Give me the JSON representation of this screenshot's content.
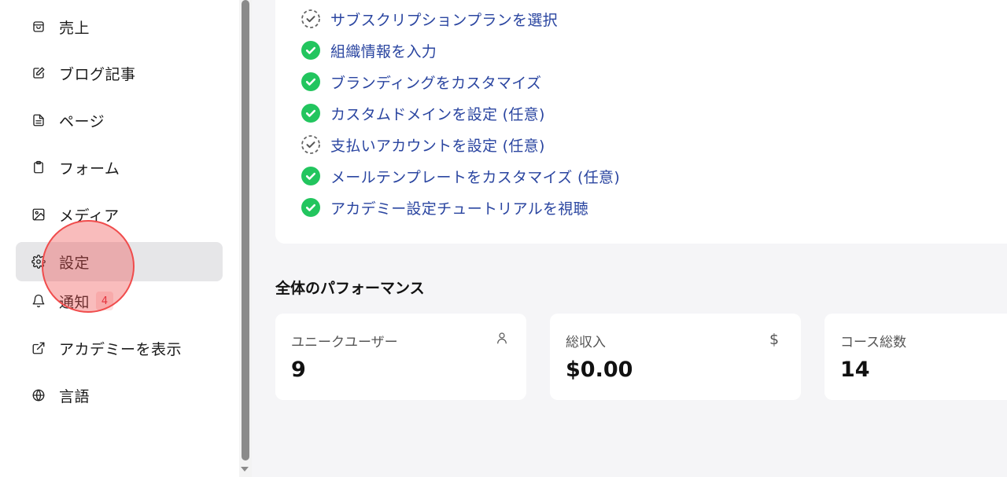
{
  "sidebar": {
    "items": [
      {
        "label": "売上",
        "icon": "shopping-bag-icon",
        "active": false
      },
      {
        "label": "ブログ記事",
        "icon": "edit-icon",
        "active": false
      },
      {
        "label": "ページ",
        "icon": "file-text-icon",
        "active": false
      },
      {
        "label": "フォーム",
        "icon": "clipboard-icon",
        "active": false
      },
      {
        "label": "メディア",
        "icon": "image-icon",
        "active": false
      },
      {
        "label": "設定",
        "icon": "gear-icon",
        "active": true
      },
      {
        "label": "通知",
        "icon": "bell-icon",
        "active": false,
        "badge": "4"
      },
      {
        "label": "アカデミーを表示",
        "icon": "external-link-icon",
        "active": false
      },
      {
        "label": "言語",
        "icon": "globe-icon",
        "active": false
      }
    ]
  },
  "checklist": {
    "items": [
      {
        "label": "サブスクリプションプランを選択",
        "status": "pending"
      },
      {
        "label": "組織情報を入力",
        "status": "done"
      },
      {
        "label": "ブランディングをカスタマイズ",
        "status": "done"
      },
      {
        "label": "カスタムドメインを設定 (任意)",
        "status": "done"
      },
      {
        "label": "支払いアカウントを設定 (任意)",
        "status": "pending"
      },
      {
        "label": "メールテンプレートをカスタマイズ (任意)",
        "status": "done"
      },
      {
        "label": "アカデミー設定チュートリアルを視聴",
        "status": "done"
      }
    ]
  },
  "performance": {
    "title": "全体のパフォーマンス",
    "stats": [
      {
        "label": "ユニークユーザー",
        "value": "9",
        "icon": "user-icon"
      },
      {
        "label": "総収入",
        "value": "$0.00",
        "icon": "dollar-icon"
      },
      {
        "label": "コース総数",
        "value": "14",
        "icon": ""
      }
    ]
  },
  "colors": {
    "accent_text": "#2a45a0",
    "check_done": "#22c55e",
    "badge_bg": "#fde2e2",
    "badge_text": "#dd2233",
    "click_indicator": "#f04c4c"
  }
}
